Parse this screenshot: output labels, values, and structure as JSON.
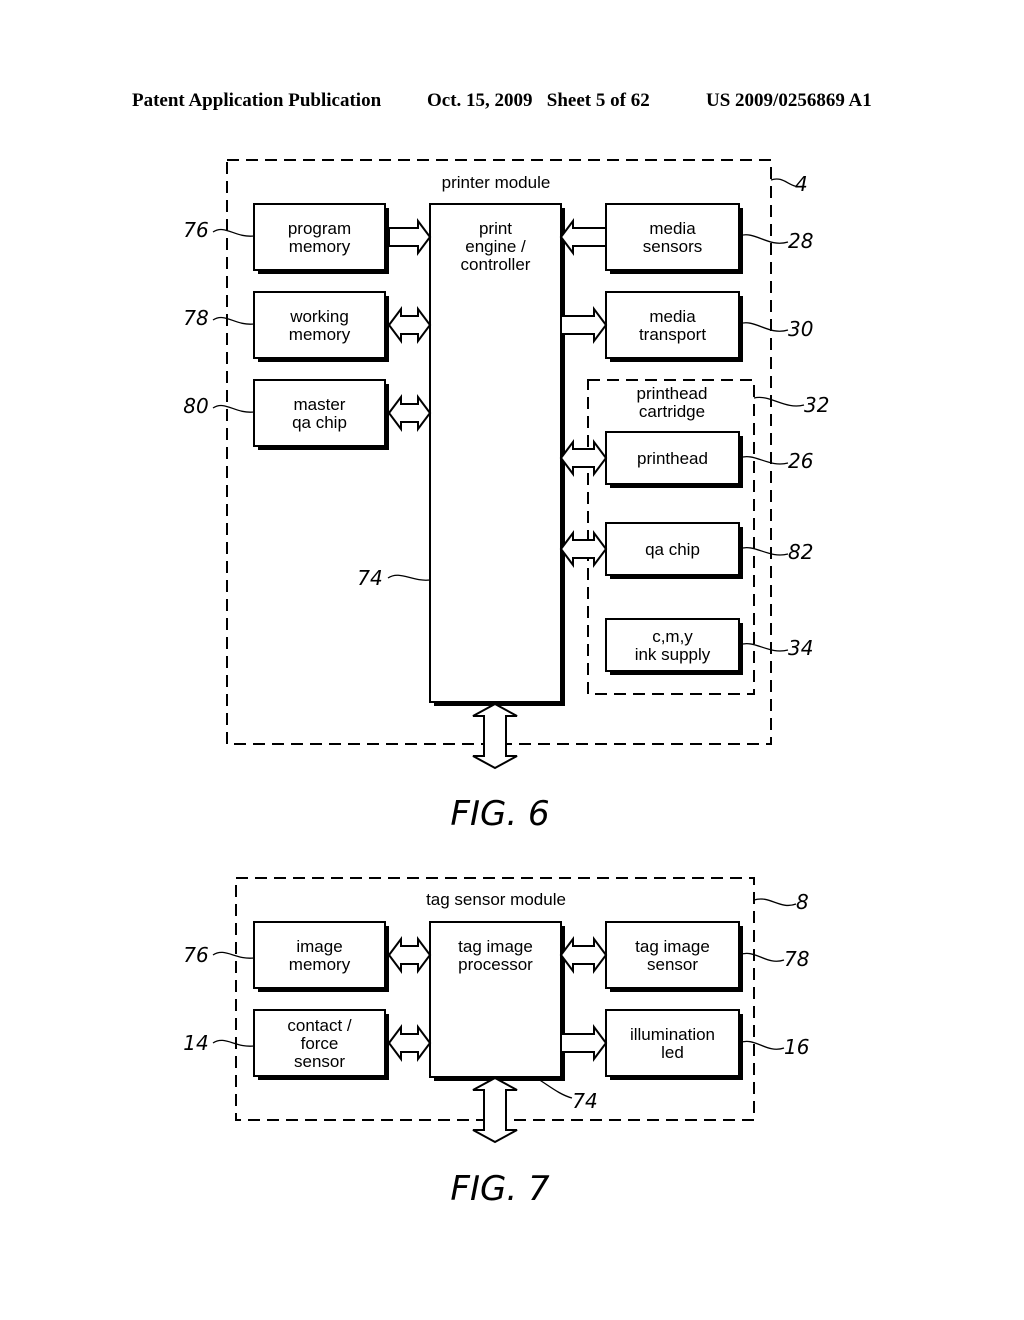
{
  "header": {
    "left": "Patent Application Publication",
    "center": "Oct. 15, 2009   Sheet 5 of 62",
    "right": "US 2009/0256869 A1"
  },
  "fig6": {
    "caption": "FIG. 6",
    "module_title": "printer module",
    "module_ref": "4",
    "controller": {
      "lines": [
        "print",
        "engine /",
        "controller"
      ],
      "ref": "74"
    },
    "left_blocks": [
      {
        "lines": [
          "program",
          "memory"
        ],
        "ref": "76",
        "link": "to-controller"
      },
      {
        "lines": [
          "working",
          "memory"
        ],
        "ref": "78",
        "link": "bidirectional"
      },
      {
        "lines": [
          "master",
          "qa chip"
        ],
        "ref": "80",
        "link": "bidirectional"
      }
    ],
    "right_blocks": [
      {
        "lines": [
          "media",
          "sensors"
        ],
        "ref": "28",
        "link": "to-controller"
      },
      {
        "lines": [
          "media",
          "transport"
        ],
        "ref": "30",
        "link": "from-controller"
      }
    ],
    "cartridge": {
      "lines": [
        "printhead",
        "cartridge"
      ],
      "ref": "32",
      "blocks": [
        {
          "lines": [
            "printhead"
          ],
          "ref": "26",
          "link": "bidirectional"
        },
        {
          "lines": [
            "qa chip"
          ],
          "ref": "82",
          "link": "bidirectional"
        },
        {
          "lines": [
            "c,m,y",
            "ink supply"
          ],
          "ref": "34",
          "link": "none"
        }
      ]
    },
    "external_link": "bidirectional"
  },
  "fig7": {
    "caption": "FIG. 7",
    "module_title": "tag sensor module",
    "module_ref": "8",
    "processor": {
      "lines": [
        "tag image",
        "processor"
      ],
      "ref": "74"
    },
    "left_blocks": [
      {
        "lines": [
          "image",
          "memory"
        ],
        "ref": "76",
        "link": "bidirectional"
      },
      {
        "lines": [
          "contact /",
          "force",
          "sensor"
        ],
        "ref": "14",
        "link": "bidirectional"
      }
    ],
    "right_blocks": [
      {
        "lines": [
          "tag image",
          "sensor"
        ],
        "ref": "78",
        "link": "bidirectional"
      },
      {
        "lines": [
          "illumination",
          "led"
        ],
        "ref": "16",
        "link": "from-controller"
      }
    ],
    "external_link": "bidirectional"
  }
}
